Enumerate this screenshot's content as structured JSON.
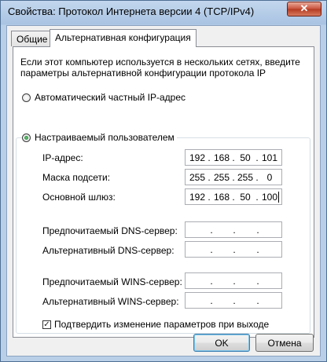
{
  "window": {
    "title": "Свойства: Протокол Интернета версии 4 (TCP/IPv4)",
    "close_label": "✕"
  },
  "tabs": [
    {
      "label": "Общие",
      "active": false
    },
    {
      "label": "Альтернативная конфигурация",
      "active": true
    }
  ],
  "description": {
    "line1": "Если этот компьютер используется в нескольких сетях, введите",
    "line2": "параметры альтернативной конфигурации протокола IP"
  },
  "options": {
    "automatic": {
      "label": "Автоматический частный IP-адрес",
      "checked": false
    },
    "user_defined": {
      "label": "Настраиваемый пользователем",
      "checked": true
    }
  },
  "fields": {
    "ip_address": {
      "label": "IP-адрес:",
      "octets": [
        "192",
        "168",
        "50",
        "101"
      ]
    },
    "subnet_mask": {
      "label": "Маска подсети:",
      "octets": [
        "255",
        "255",
        "255",
        "0"
      ]
    },
    "default_gateway": {
      "label": "Основной шлюз:",
      "octets": [
        "192",
        "168",
        "50",
        "100"
      ]
    },
    "preferred_dns": {
      "label": "Предпочитаемый DNS-сервер:",
      "octets": [
        "",
        "",
        "",
        ""
      ]
    },
    "alternate_dns": {
      "label": "Альтернативный DNS-сервер:",
      "octets": [
        "",
        "",
        "",
        ""
      ]
    },
    "preferred_wins": {
      "label": "Предпочитаемый WINS-сервер:",
      "octets": [
        "",
        "",
        "",
        ""
      ]
    },
    "alternate_wins": {
      "label": "Альтернативный WINS-сервер:",
      "octets": [
        "",
        "",
        "",
        ""
      ]
    }
  },
  "validate": {
    "label": "Подтвердить изменение параметров при выходе",
    "checked": true,
    "mark": "✓"
  },
  "buttons": {
    "ok": "OK",
    "cancel": "Отмена"
  },
  "ip_separator": "."
}
